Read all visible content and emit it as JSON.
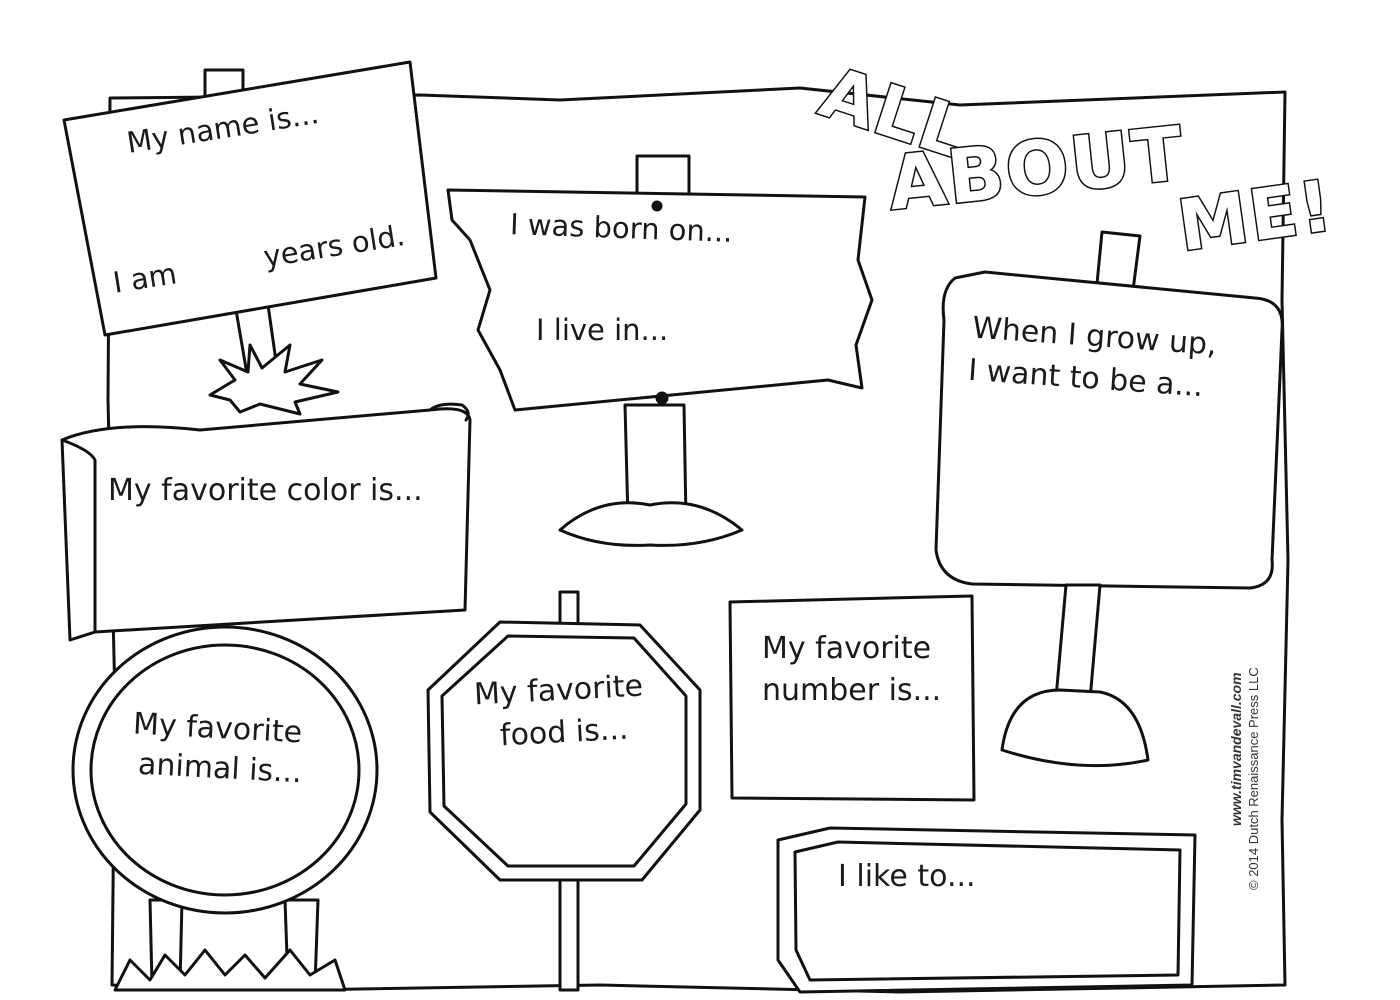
{
  "title": {
    "line1": "ALL",
    "line2": "ABOUT",
    "line3": "ME!"
  },
  "signs": {
    "name": {
      "prompt": "My name is...",
      "age_prefix": "I am",
      "age_suffix": "years old."
    },
    "born": {
      "born_on": "I was born on...",
      "live_in": "I live in..."
    },
    "color": {
      "prompt": "My favorite color is..."
    },
    "grow_up": {
      "line1": "When I grow up,",
      "line2": "I want to be a..."
    },
    "animal": {
      "line1": "My favorite",
      "line2": "animal is..."
    },
    "food": {
      "line1": "My favorite",
      "line2": "food is..."
    },
    "number": {
      "line1": "My favorite",
      "line2": "number is..."
    },
    "like_to": {
      "prompt": "I like to..."
    }
  },
  "credits": {
    "website": "www.timvandevall.com",
    "copyright": "© 2014 Dutch Renaissance Press LLC"
  },
  "icons": [
    "wooden-post-icon",
    "grass-tuft-icon",
    "dirt-mound-icon",
    "bolt-hole-icon"
  ]
}
